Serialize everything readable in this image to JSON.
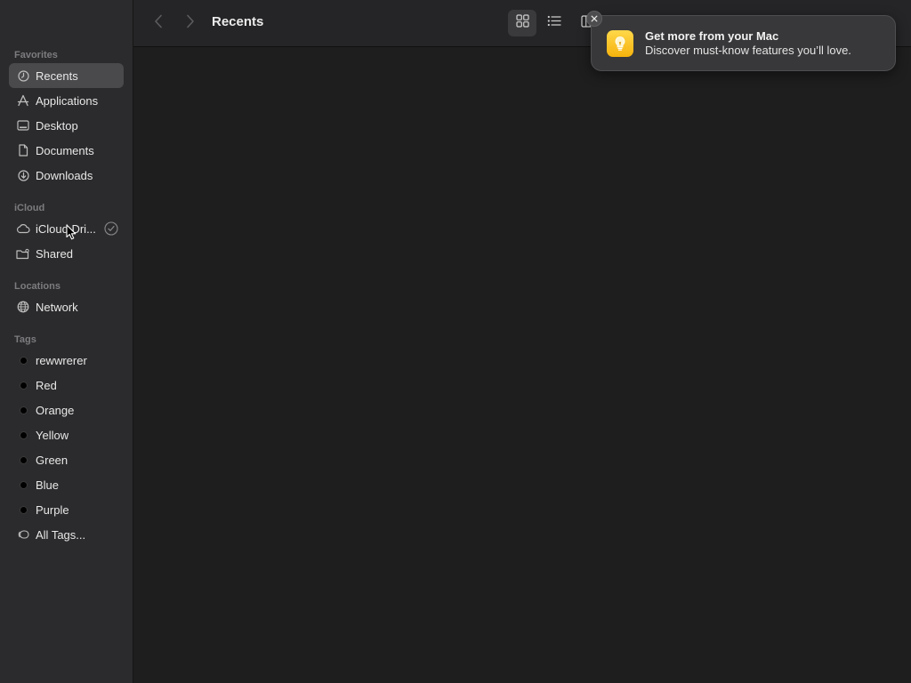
{
  "window": {
    "title": "Recents"
  },
  "sidebar": {
    "favorites_header": "Favorites",
    "favorites": [
      {
        "label": "Recents",
        "icon": "clock-icon",
        "selected": true
      },
      {
        "label": "Applications",
        "icon": "applications-icon"
      },
      {
        "label": "Desktop",
        "icon": "desktop-icon"
      },
      {
        "label": "Documents",
        "icon": "document-icon"
      },
      {
        "label": "Downloads",
        "icon": "downloads-icon"
      }
    ],
    "icloud_header": "iCloud",
    "icloud": [
      {
        "label": "iCloud Dri...",
        "icon": "cloud-icon",
        "badge": "sync-status-icon"
      },
      {
        "label": "Shared",
        "icon": "shared-folder-icon"
      }
    ],
    "locations_header": "Locations",
    "locations": [
      {
        "label": "Network",
        "icon": "globe-icon"
      }
    ],
    "tags_header": "Tags",
    "tags": [
      {
        "label": "rewwrerer"
      },
      {
        "label": "Red"
      },
      {
        "label": "Orange"
      },
      {
        "label": "Yellow"
      },
      {
        "label": "Green"
      },
      {
        "label": "Blue"
      },
      {
        "label": "Purple"
      },
      {
        "label": "All Tags...",
        "icon": "all-tags-icon"
      }
    ]
  },
  "toolbar": {
    "icons": [
      "back-icon",
      "forward-icon",
      "grid-view-icon",
      "list-view-icon",
      "column-view-icon"
    ]
  },
  "notification": {
    "title": "Get more from your Mac",
    "body": "Discover must-know features you’ll love.",
    "icon": "lightbulb-icon"
  },
  "colors": {
    "sidebar_bg": "#2b2b2d",
    "content_bg": "#1e1e1e",
    "selection_bg": "#4a4a4d",
    "notification_bg": "#38383a",
    "tip_icon_yellow": "#f6b20d"
  }
}
